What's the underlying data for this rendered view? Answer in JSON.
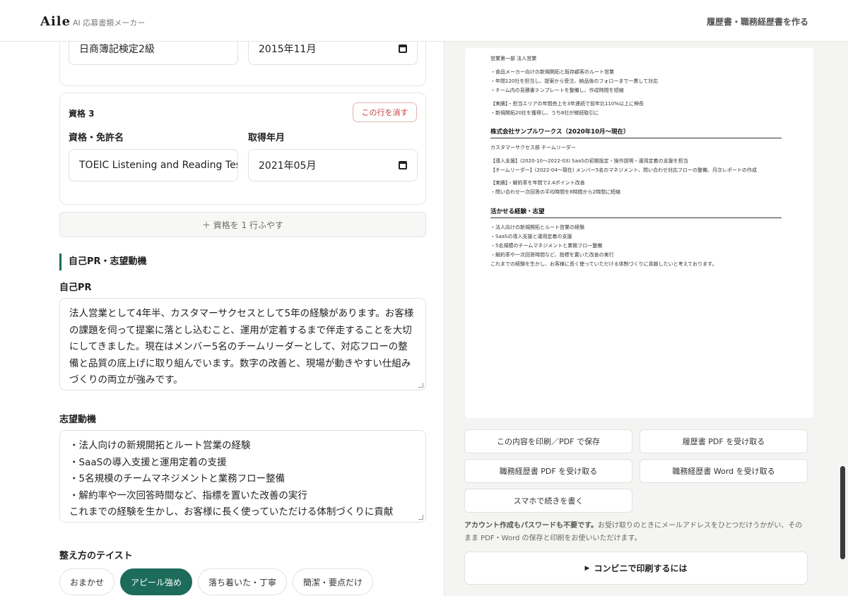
{
  "header": {
    "logo": "Aile",
    "tagline": "AI 応募書類メーカー",
    "link": "履歴書・職務経歴書を作る"
  },
  "qualifications": {
    "prev_row": {
      "name": "日商簿記検定2級",
      "date": "2015年11月"
    },
    "row3": {
      "title": "資格 3",
      "delete_label": "この行を消す",
      "name_label": "資格・免許名",
      "date_label": "取得年月",
      "name_value": "TOEIC Listening and Reading Tes",
      "date_value": "2021年05月"
    },
    "add_row_label": "＋ 資格を 1 行ふやす"
  },
  "pr_section": {
    "title": "自己PR・志望動機",
    "self_pr_label": "自己PR",
    "self_pr_text": "法人営業として4年半、カスタマーサクセスとして5年の経験があります。お客様の課題を伺って提案に落とし込むこと、運用が定着するまで伴走することを大切にしてきました。現在はメンバー5名のチームリーダーとして、対応フローの整備と品質の底上げに取り組んでいます。数字の改善と、現場が動きやすい仕組みづくりの両立が強みです。",
    "motivation_label": "志望動機",
    "motivation_lines": [
      "・法人向けの新規開拓とルート営業の経験",
      "・SaaSの導入支援と運用定着の支援",
      "・5名規模のチームマネジメントと業務フロー整備",
      "・解約率や一次回答時間など、指標を置いた改善の実行",
      "これまでの経験を生かし、お客様に長く使っていただける体制づくりに貢献"
    ]
  },
  "taste": {
    "label": "整え方のテイスト",
    "options": [
      "おまかせ",
      "アピール強め",
      "落ち着いた・丁寧",
      "簡潔・要点だけ"
    ],
    "selected": "アピール強め"
  },
  "preview": {
    "lines": [
      "営業第一部 法人営業",
      "・食品メーカー向けの新規開拓と既存顧客のルート営業",
      "・年間120社を担当し、提案から受注、納品後のフォローまで一貫して対応",
      "・チーム内の見積書テンプレートを整備し、作成時間を短縮",
      "【実績】・担当エリアの年間売上を3年連続で前年比110%以上に伸長",
      "・新規開拓20社を獲得し、うち8社が継続取引に"
    ],
    "company2_heading": "株式会社サンプルワークス（2020年10月〜現在）",
    "company2_lines": [
      "カスタマーサクセス部 チームリーダー",
      "【導入支援】(2020-10〜2022-03) SaaSの初期設定・操作説明・運用定着の支援を担当",
      "【チームリーダー】(2022-04〜現在) メンバー5名のマネジメント、問い合わせ対応フローの整備、月次レポートの作成",
      "【実績】・解約率を年間で2.4ポイント改善",
      "・問い合わせ一次回答の平均時間を8時間から2時間に短縮"
    ],
    "skills_heading": "活かせる経験・志望",
    "skills_lines": [
      "・法人向けの新規開拓とルート営業の経験",
      "・SaaSの導入支援と運用定着の支援",
      "・5名規模のチームマネジメントと業務フロー整備",
      "・解約率や一次回答時間など、指標を置いた改善の実行",
      "これまでの経験を生かし、お客様に長く使っていただける体制づくりに貢献したいと考えております。"
    ]
  },
  "actions": {
    "print_pdf": "この内容を印刷／PDF で保存",
    "resume_pdf": "履歴書 PDF を受け取る",
    "cv_pdf": "職務経歴書 PDF を受け取る",
    "cv_word": "職務経歴書 Word を受け取る",
    "mobile": "スマホで続きを書く"
  },
  "note": {
    "bold": "アカウント作成もパスワードも不要です。",
    "text": "お受け取りのときにメールアドレスをひとつだけうかがい、そのまま PDF・Word の保存と印刷をお使いいただけます。"
  },
  "convenience_label": "コンビニで印刷するには"
}
